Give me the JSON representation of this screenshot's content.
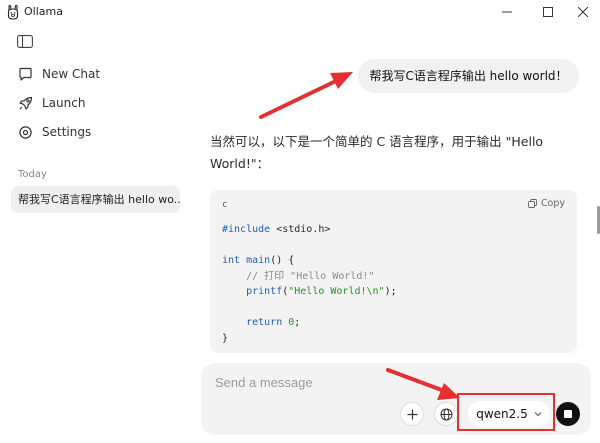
{
  "window": {
    "title": "Ollama"
  },
  "sidebar": {
    "items": [
      {
        "label": "New Chat",
        "icon": "chat-bubble-icon"
      },
      {
        "label": "Launch",
        "icon": "rocket-icon"
      },
      {
        "label": "Settings",
        "icon": "gear-icon"
      }
    ],
    "section_label": "Today",
    "history": [
      {
        "label": "帮我写C语言程序输出 hello wo..."
      }
    ]
  },
  "conversation": {
    "user_message": "帮我写C语言程序输出 hello world！",
    "assistant_text": "当然可以，以下是一个简单的 C 语言程序，用于输出 \"Hello World!\"：",
    "code": {
      "language": "c",
      "copy_label": "Copy"
    }
  },
  "composer": {
    "placeholder": "Send a message",
    "model": "qwen2.5"
  },
  "colors": {
    "annotation": "#e33030",
    "bubble": "#f1f1f1",
    "code_bg": "#f3f3f3"
  }
}
